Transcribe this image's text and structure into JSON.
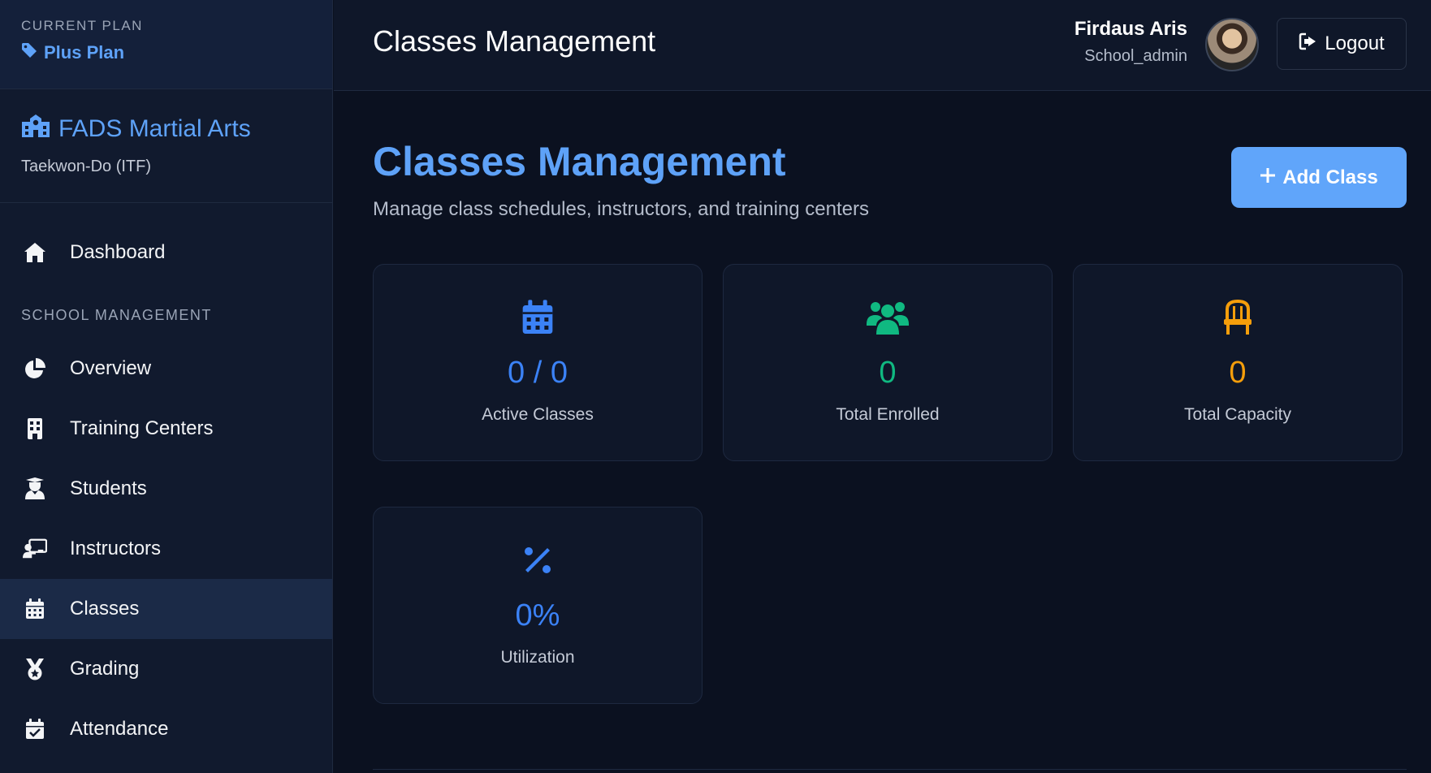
{
  "plan": {
    "caption": "CURRENT PLAN",
    "name": "Plus Plan"
  },
  "school": {
    "name": "FADS Martial Arts",
    "style": "Taekwon-Do (ITF)"
  },
  "nav": {
    "dashboard": "Dashboard",
    "section_label": "SCHOOL MANAGEMENT",
    "overview": "Overview",
    "training_centers": "Training Centers",
    "students": "Students",
    "instructors": "Instructors",
    "classes": "Classes",
    "grading": "Grading",
    "attendance": "Attendance"
  },
  "header": {
    "title": "Classes Management",
    "user_name": "Firdaus Aris",
    "user_role": "School_admin",
    "logout_label": "Logout"
  },
  "main": {
    "title": "Classes Management",
    "subtitle": "Manage class schedules, instructors, and training centers",
    "add_button_label": "Add Class"
  },
  "stats": {
    "active_classes": {
      "value": "0 / 0",
      "label": "Active Classes",
      "color": "#3b82f6"
    },
    "total_enrolled": {
      "value": "0",
      "label": "Total Enrolled",
      "color": "#10b981"
    },
    "total_capacity": {
      "value": "0",
      "label": "Total Capacity",
      "color": "#f59e0b"
    },
    "utilization": {
      "value": "0%",
      "label": "Utilization",
      "color": "#3b82f6"
    }
  },
  "colors": {
    "accent": "#60a5fa",
    "sidebar_bg": "#111a2e",
    "page_bg": "#0b1120",
    "active_nav_bg": "#1b2a47"
  },
  "icons": {
    "plan": "tag-icon",
    "school": "school-icon",
    "dashboard": "home-icon",
    "overview": "pie-chart-icon",
    "training_centers": "building-icon",
    "students": "graduate-icon",
    "instructors": "chalkboard-teacher-icon",
    "classes": "calendar-icon",
    "grading": "medal-icon",
    "attendance": "calendar-check-icon",
    "logout": "sign-out-icon",
    "add": "plus-icon",
    "active_classes": "calendar-icon",
    "total_enrolled": "users-icon",
    "total_capacity": "chair-icon",
    "utilization": "percent-icon"
  }
}
